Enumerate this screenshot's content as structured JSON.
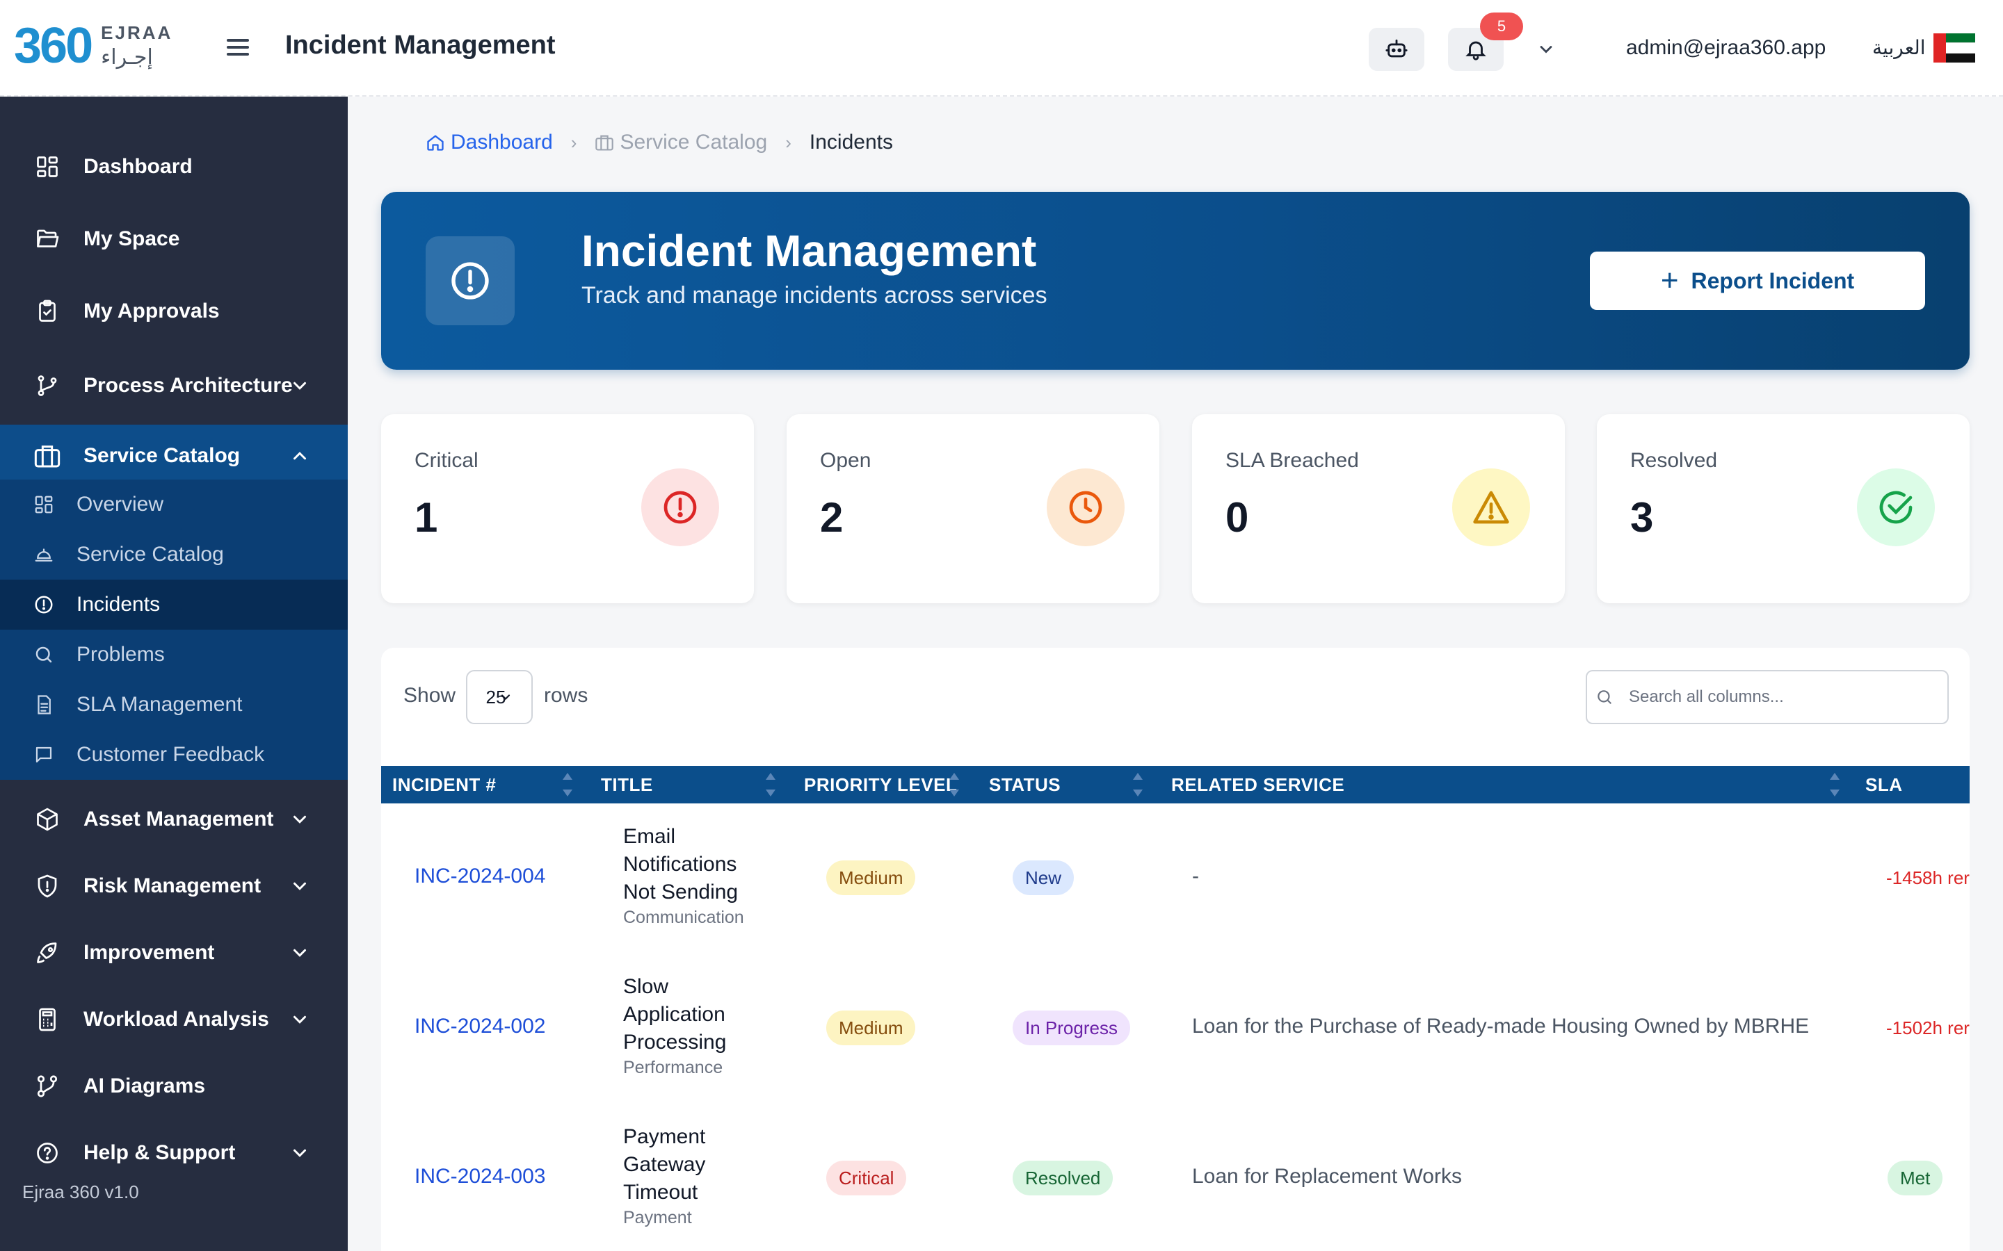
{
  "app": {
    "logo_number": "360",
    "logo_en": "EJRAA",
    "logo_ar": "إجـراء",
    "page_title": "Incident Management",
    "notification_count": "5",
    "user_email": "admin@ejraa360.app",
    "language_toggle": "العربية",
    "version": "Ejraa 360 v1.0"
  },
  "sidebar": {
    "items": [
      {
        "label": "Dashboard",
        "icon": "dashboard-grid-icon"
      },
      {
        "label": "My Space",
        "icon": "folder-open-icon"
      },
      {
        "label": "My Approvals",
        "icon": "clipboard-check-icon"
      },
      {
        "label": "Process Architecture",
        "icon": "git-branch-icon"
      },
      {
        "label": "Service Catalog",
        "icon": "briefcase-icon"
      },
      {
        "label": "Asset Management",
        "icon": "cube-icon"
      },
      {
        "label": "Risk Management",
        "icon": "shield-alert-icon"
      },
      {
        "label": "Improvement",
        "icon": "rocket-icon"
      },
      {
        "label": "Workload Analysis",
        "icon": "calculator-icon"
      },
      {
        "label": "AI Diagrams",
        "icon": "workflow-icon"
      },
      {
        "label": "Help & Support",
        "icon": "help-circle-icon"
      }
    ],
    "service_catalog_sub": [
      {
        "label": "Overview",
        "icon": "grid-icon"
      },
      {
        "label": "Service Catalog",
        "icon": "service-bell-icon"
      },
      {
        "label": "Incidents",
        "icon": "alert-circle-icon"
      },
      {
        "label": "Problems",
        "icon": "search-icon"
      },
      {
        "label": "SLA Management",
        "icon": "document-icon"
      },
      {
        "label": "Customer Feedback",
        "icon": "message-square-icon"
      }
    ]
  },
  "breadcrumb": {
    "home": "Dashboard",
    "parent": "Service Catalog",
    "current": "Incidents"
  },
  "hero": {
    "title": "Incident Management",
    "subtitle": "Track and manage incidents across services",
    "button_label": "Report Incident"
  },
  "stats": [
    {
      "label": "Critical",
      "value": "1",
      "color": "#dc2626",
      "bg": "#fde2e2",
      "icon": "alert-circle-icon"
    },
    {
      "label": "Open",
      "value": "2",
      "color": "#ea580c",
      "bg": "#fde8d2",
      "icon": "clock-icon"
    },
    {
      "label": "SLA Breached",
      "value": "0",
      "color": "#ca8a04",
      "bg": "#fef7c3",
      "icon": "warning-triangle-icon"
    },
    {
      "label": "Resolved",
      "value": "3",
      "color": "#16a34a",
      "bg": "#dcfce7",
      "icon": "check-circle-icon"
    }
  ],
  "table": {
    "show_label": "Show",
    "rows_value": "25",
    "rows_label": "rows",
    "search_placeholder": "Search all columns...",
    "columns": [
      "INCIDENT #",
      "TITLE",
      "PRIORITY LEVEL",
      "STATUS",
      "RELATED SERVICE",
      "SLA"
    ],
    "rows": [
      {
        "id": "INC-2024-004",
        "title_lines": [
          "Email",
          "Notifications",
          "Not Sending"
        ],
        "category": "Communication",
        "priority": "Medium",
        "status": "New",
        "service": "-",
        "sla": "-1458h rer"
      },
      {
        "id": "INC-2024-002",
        "title_lines": [
          "Slow",
          "Application",
          "Processing"
        ],
        "category": "Performance",
        "priority": "Medium",
        "status": "In Progress",
        "service": "Loan for the Purchase of Ready-made Housing Owned by MBRHE",
        "sla": "-1502h rer"
      },
      {
        "id": "INC-2024-003",
        "title_lines": [
          "Payment",
          "Gateway",
          "Timeout"
        ],
        "category": "Payment",
        "priority": "Critical",
        "status": "Resolved",
        "service": "Loan for Replacement Works",
        "sla": "Met"
      }
    ]
  }
}
